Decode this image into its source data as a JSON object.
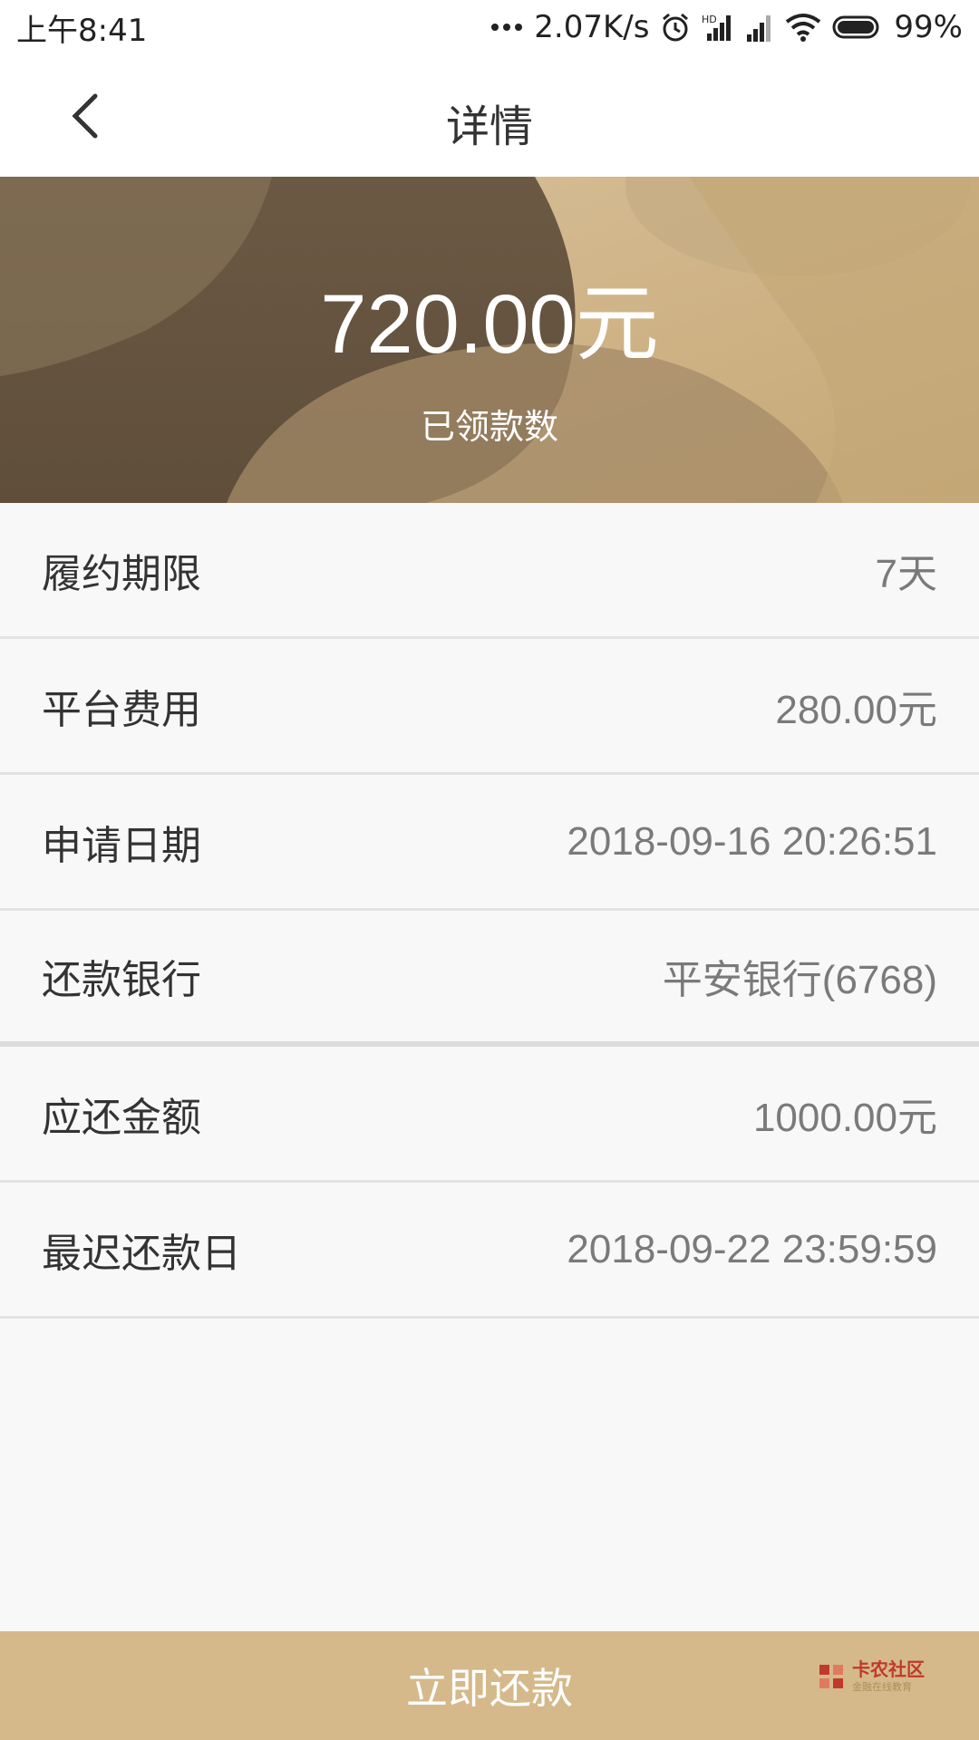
{
  "status_bar": {
    "time": "上午8:41",
    "network_speed": "2.07K/s",
    "battery": "99%",
    "hd_label": "HD"
  },
  "nav": {
    "title": "详情"
  },
  "hero": {
    "amount": "720.00元",
    "label": "已领款数"
  },
  "details": [
    {
      "label": "履约期限",
      "value": "7天"
    },
    {
      "label": "平台费用",
      "value": "280.00元"
    },
    {
      "label": "申请日期",
      "value": "2018-09-16 20:26:51"
    },
    {
      "label": "还款银行",
      "value": "平安银行(6768)"
    },
    {
      "label": "应还金额",
      "value": "1000.00元"
    },
    {
      "label": "最迟还款日",
      "value": "2018-09-22 23:59:59"
    }
  ],
  "action": {
    "repay_label": "立即还款"
  },
  "watermark": {
    "main": "卡农社区",
    "sub": "金融在线教育"
  },
  "colors": {
    "accent": "#d5b98a",
    "hero_dark": "#685640",
    "hero_light": "#d2b78c"
  }
}
